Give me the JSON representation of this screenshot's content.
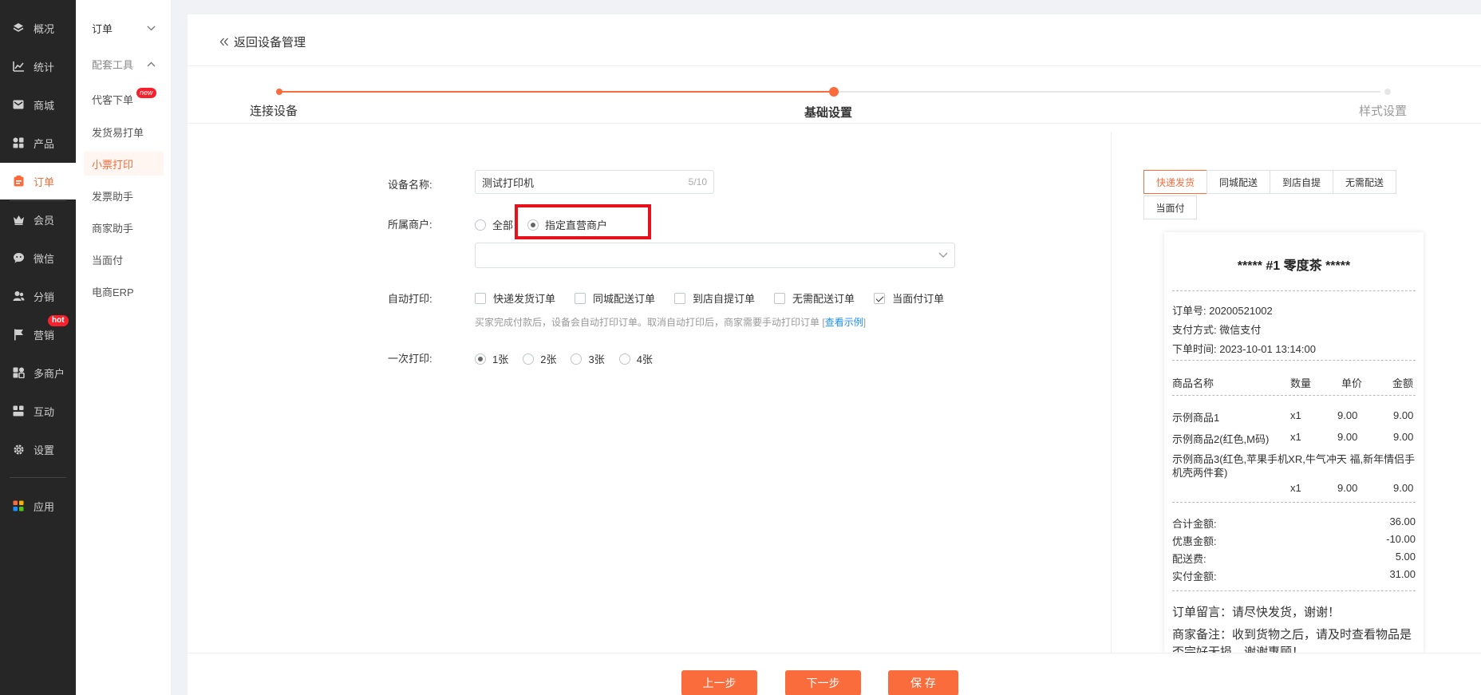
{
  "nav": {
    "items": [
      {
        "label": "概况",
        "icon": "layers-icon"
      },
      {
        "label": "统计",
        "icon": "chart-icon"
      },
      {
        "label": "商城",
        "icon": "mail-icon"
      },
      {
        "label": "产品",
        "icon": "grid-icon"
      },
      {
        "label": "订单",
        "icon": "order-icon"
      },
      {
        "label": "会员",
        "icon": "crown-icon"
      },
      {
        "label": "微信",
        "icon": "wechat-icon"
      },
      {
        "label": "分销",
        "icon": "users-icon"
      },
      {
        "label": "营销",
        "icon": "flag-icon"
      },
      {
        "label": "多商户",
        "icon": "merchant-icon"
      },
      {
        "label": "互动",
        "icon": "interact-icon"
      },
      {
        "label": "设置",
        "icon": "gear-icon"
      },
      {
        "label": "应用",
        "icon": "apps-icon"
      }
    ],
    "active_index": 4,
    "hot_badge": "hot",
    "accent": "#fa6c3c"
  },
  "submenu": {
    "group1": "订单",
    "group2": "配套工具",
    "items": [
      "代客下单",
      "发货易打单",
      "小票打印",
      "发票助手",
      "商家助手",
      "当面付",
      "电商ERP"
    ],
    "new_badge": "new",
    "active": "小票打印"
  },
  "header": {
    "back_label": "返回设备管理"
  },
  "steps": {
    "labels": [
      "连接设备",
      "基础设置",
      "样式设置"
    ],
    "current": 2
  },
  "form": {
    "device_name_label": "设备名称:",
    "device_name_value": "测试打印机",
    "device_name_count": "5/10",
    "merchant_label": "所属商户:",
    "merchant_options": [
      "全部",
      "指定直营商户"
    ],
    "merchant_selected": "指定直营商户",
    "auto_print_label": "自动打印:",
    "auto_print_options": [
      {
        "label": "快递发货订单",
        "checked": false
      },
      {
        "label": "同城配送订单",
        "checked": false
      },
      {
        "label": "到店自提订单",
        "checked": false
      },
      {
        "label": "无需配送订单",
        "checked": false
      },
      {
        "label": "当面付订单",
        "checked": true
      }
    ],
    "auto_print_hint": "买家完成付款后，设备会自动打印订单。取消自动打印后，商家需要手动打印订单",
    "hint_link_open": "[",
    "hint_link": "查看示例",
    "hint_link_close": "]",
    "copies_label": "一次打印:",
    "copies_options": [
      "1张",
      "2张",
      "3张",
      "4张"
    ],
    "copies_selected": "1张"
  },
  "preview": {
    "tabs": [
      "快递发货",
      "同城配送",
      "到店自提",
      "无需配送",
      "当面付"
    ],
    "active_tab": "快递发货",
    "receipt": {
      "title": "***** #1  零度茶 *****",
      "order_no": "订单号: 20200521002",
      "pay_method": "支付方式: 微信支付",
      "order_time": "下单时间: 2023-10-01 13:14:00",
      "headers": [
        "商品名称",
        "数量",
        "单价",
        "金额"
      ],
      "rows": [
        {
          "name": "示例商品1",
          "qty": "x1",
          "price": "9.00",
          "amount": "9.00"
        },
        {
          "name": "示例商品2(红色,M码)",
          "qty": "x1",
          "price": "9.00",
          "amount": "9.00"
        },
        {
          "name": "示例商品3(红色,苹果手机XR,牛气冲天 福,新年情侣手机壳两件套)",
          "qty": "x1",
          "price": "9.00",
          "amount": "9.00"
        }
      ],
      "totals": [
        {
          "label": "合计金额:",
          "value": "36.00"
        },
        {
          "label": "优惠金额:",
          "value": "-10.00"
        },
        {
          "label": "配送费:",
          "value": "5.00"
        },
        {
          "label": "实付金额:",
          "value": "31.00"
        }
      ],
      "buyer_note": "订单留言：请尽快发货，谢谢！",
      "merchant_note": "商家备注：收到货物之后，请及时查看物品是否完好无损，谢谢惠顾！"
    }
  },
  "footer": {
    "prev": "上一步",
    "next": "下一步",
    "save": "保 存"
  }
}
